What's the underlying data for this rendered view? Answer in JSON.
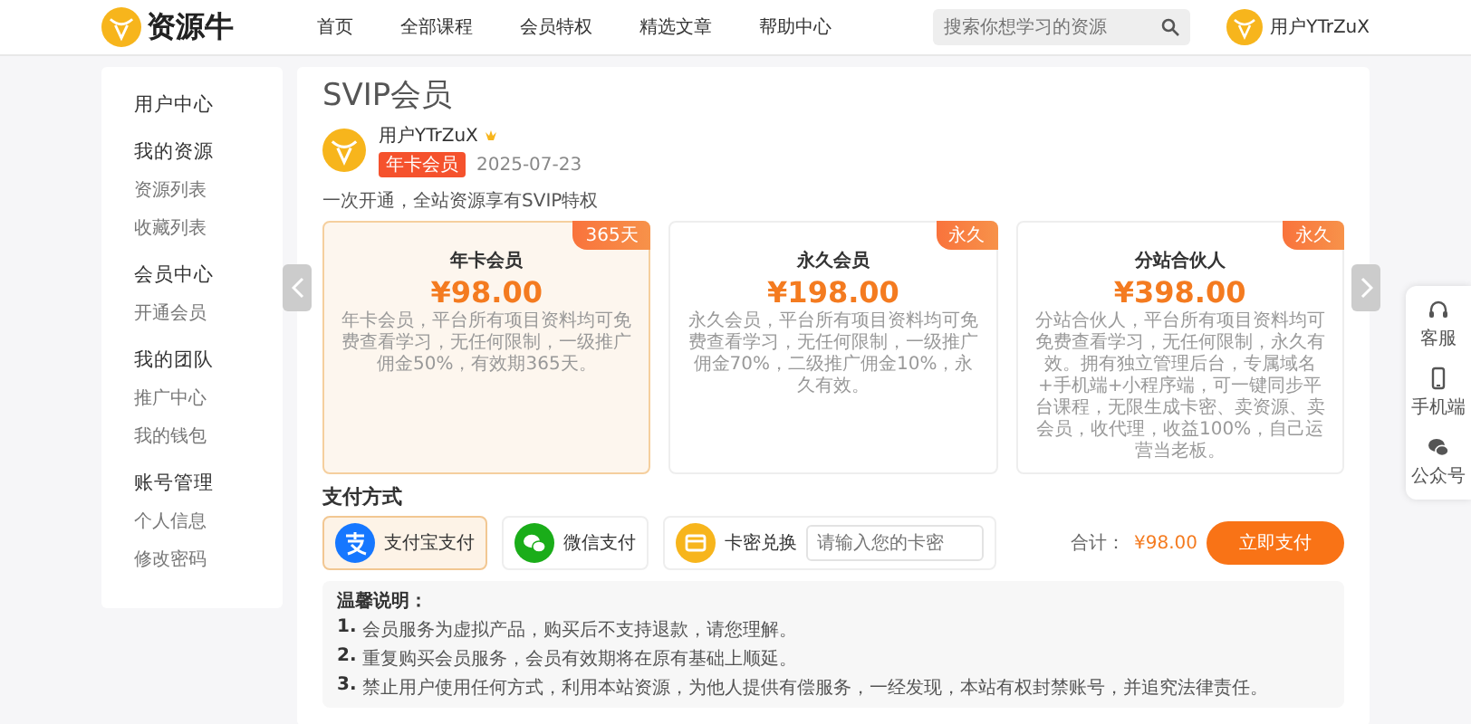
{
  "header": {
    "logo": "资源牛",
    "nav": [
      {
        "label": "首页",
        "selected": false
      },
      {
        "label": "全部课程",
        "selected": false
      },
      {
        "label": "会员特权",
        "selected": false
      },
      {
        "label": "精选文章",
        "selected": false
      },
      {
        "label": "帮助中心",
        "selected": false
      }
    ],
    "search": {
      "placeholder": "搜索你想学习的资源"
    },
    "user": "用户YTrZuX"
  },
  "sidebar": {
    "groups": [
      {
        "title": "用户中心"
      },
      {
        "title": "我的资源",
        "items": [
          "资源列表",
          "收藏列表"
        ]
      },
      {
        "title": "会员中心",
        "items": [
          "开通会员"
        ]
      },
      {
        "title": "我的团队",
        "items": [
          "推广中心",
          "我的钱包"
        ]
      },
      {
        "title": "账号管理",
        "items": [
          "个人信息",
          "修改密码"
        ]
      }
    ]
  },
  "page": {
    "title": "SVIP会员",
    "profile": {
      "name": "用户YTrZuX",
      "tag": "年卡会员",
      "date": "2025-07-23"
    },
    "intro": "一次开通，全站资源享有SVIP特权",
    "plans": [
      {
        "name": "年卡会员",
        "price": "¥98.00",
        "badge": "365天",
        "description": "年卡会员，平台所有项目资料均可免费查看学习，无任何限制，一级推广佣金50%，有效期365天。",
        "selected": true
      },
      {
        "name": "永久会员",
        "price": "¥198.00",
        "badge": "永久",
        "description": "永久会员，平台所有项目资料均可免费查看学习，无任何限制，一级推广佣金70%，二级推广佣金10%，永久有效。",
        "selected": false
      },
      {
        "name": "分站合伙人",
        "price": "¥398.00",
        "badge": "永久",
        "description": "分站合伙人，平台所有项目资料均可免费查看学习，无任何限制，永久有效。拥有独立管理后台，专属域名+手机端+小程序端，可一键同步平台课程，无限生成卡密、卖资源、卖会员，收代理，收益100%，自己运营当老板。",
        "selected": false
      }
    ],
    "payment_title": "支付方式",
    "payments": [
      {
        "kind": "alipay",
        "label": "支付宝支付",
        "selected": true
      },
      {
        "kind": "wechat",
        "label": "微信支付",
        "selected": false
      },
      {
        "kind": "card",
        "label": "卡密兑换",
        "placeholder": "请输入您的卡密",
        "selected": false
      }
    ],
    "total_label": "合计：",
    "total": "¥98.00",
    "pay_button": "立即支付",
    "notes": {
      "title": "温馨说明：",
      "items": [
        {
          "number": "1.",
          "text": "会员服务为虚拟产品，购买后不支持退款，请您理解。"
        },
        {
          "number": "2.",
          "text": "重复购买会员服务，会员有效期将在原有基础上顺延。"
        },
        {
          "number": "3.",
          "text": "禁止用户使用任何方式，利用本站资源，为他人提供有偿服务，一经发现，本站有权封禁账号，并追究法律责任。"
        }
      ]
    }
  },
  "float_bar": [
    {
      "kind": "service",
      "label": "客服"
    },
    {
      "kind": "phone",
      "label": "手机端"
    },
    {
      "kind": "wechat",
      "label": "公众号"
    }
  ]
}
